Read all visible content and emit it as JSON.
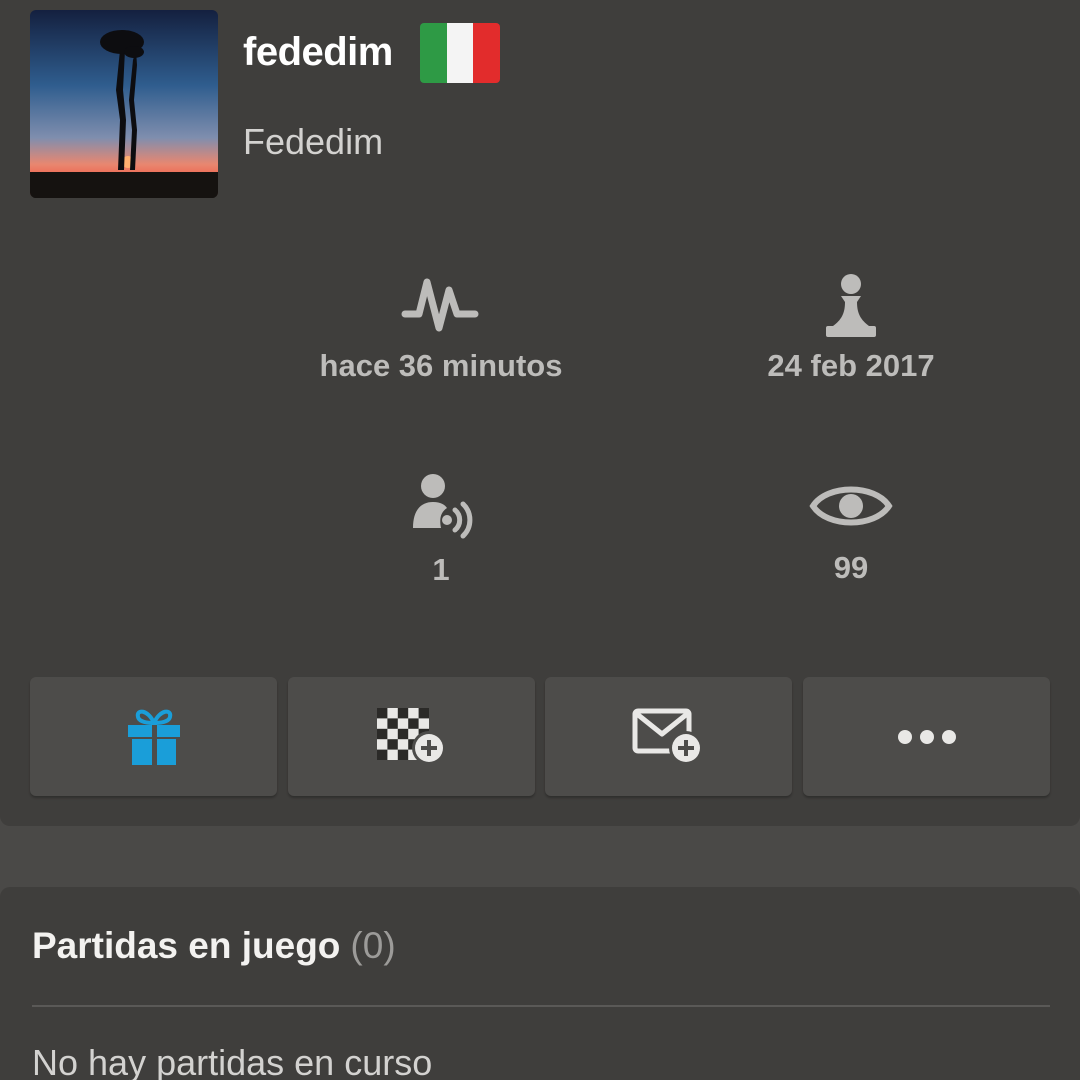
{
  "profile": {
    "username": "fededim",
    "real_name": "Fededim",
    "flag_colors": [
      "#2e9a45",
      "#f4f4f4",
      "#e22c2c"
    ]
  },
  "stats": {
    "last_seen": "hace 36 minutos",
    "member_since": "24 feb 2017",
    "followers": "1",
    "views": "99"
  },
  "colors": {
    "accent_blue": "#1a9ed9",
    "icon_gray": "#bdbcba"
  },
  "games": {
    "title": "Partidas en juego",
    "count": "(0)",
    "empty_message": "No hay partidas en curso"
  }
}
